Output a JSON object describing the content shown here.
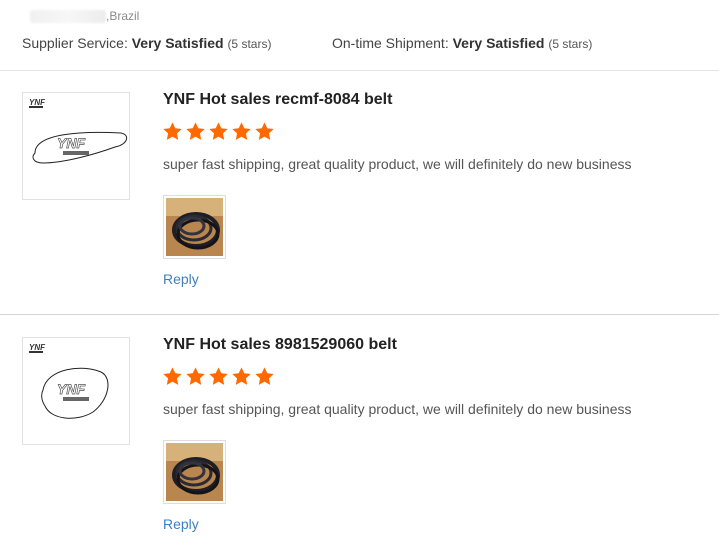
{
  "location": {
    "country": ",Brazil"
  },
  "supplier": {
    "service_label": "Supplier Service:",
    "service_value": "Very Satisfied",
    "service_stars": "(5 stars)",
    "shipment_label": "On-time Shipment:",
    "shipment_value": "Very Satisfied",
    "shipment_stars": "(5 stars)"
  },
  "reviews": [
    {
      "product_title": "YNF Hot sales recmf-8084 belt",
      "rating": 5,
      "text": "super fast shipping, great quality product, we will definitely do new business",
      "reply_label": "Reply"
    },
    {
      "product_title": "YNF Hot sales 8981529060 belt",
      "rating": 5,
      "text": "super fast shipping, great quality product, we will definitely do new business",
      "reply_label": "Reply"
    }
  ],
  "colors": {
    "star": "#ff6a00",
    "link": "#3c7fc2"
  },
  "icons": {
    "star": "star-icon"
  }
}
